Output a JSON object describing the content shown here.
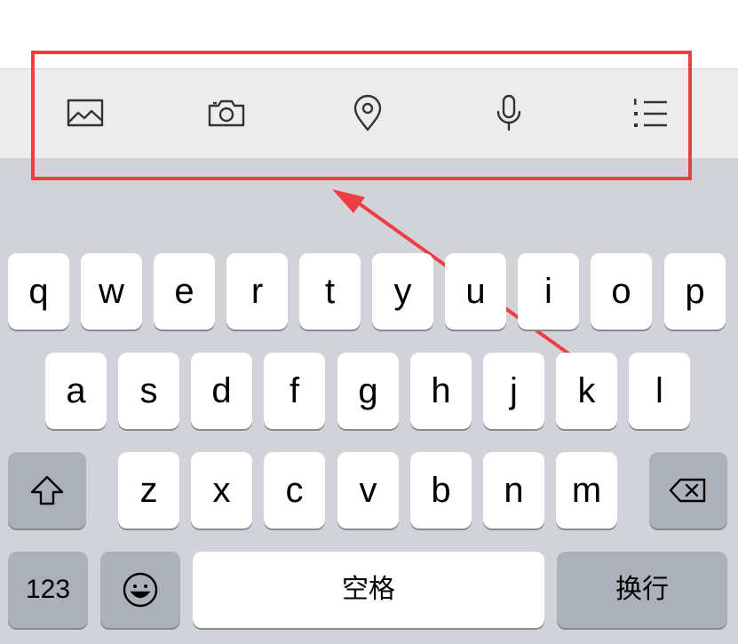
{
  "toolbar": {
    "icons": [
      "image-icon",
      "camera-icon",
      "location-pin-icon",
      "microphone-icon",
      "numbered-list-icon"
    ]
  },
  "annotation": {
    "highlight_color": "#ef3e42"
  },
  "keyboard": {
    "row1": [
      "q",
      "w",
      "e",
      "r",
      "t",
      "y",
      "u",
      "i",
      "o",
      "p"
    ],
    "row2": [
      "a",
      "s",
      "d",
      "f",
      "g",
      "h",
      "j",
      "k",
      "l"
    ],
    "row3": [
      "z",
      "x",
      "c",
      "v",
      "b",
      "n",
      "m"
    ],
    "numbers_label": "123",
    "space_label": "空格",
    "return_label": "换行"
  },
  "colors": {
    "keyboard_bg": "#d1d3d9",
    "toolbar_bg": "#ececec",
    "key_bg": "#ffffff",
    "function_key_bg": "#abb0bb"
  }
}
